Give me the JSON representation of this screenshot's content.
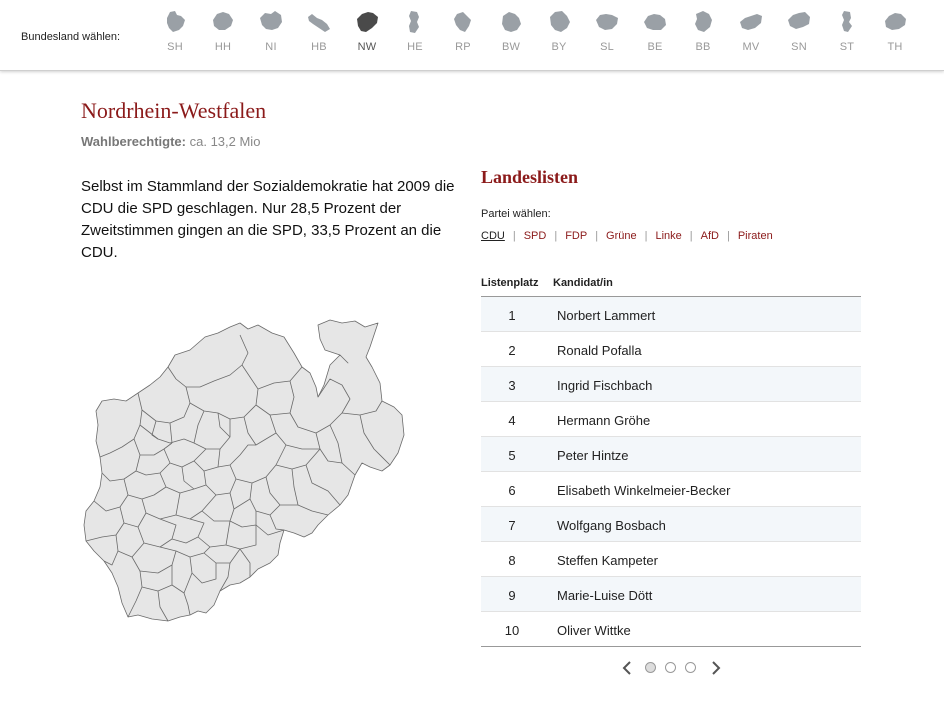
{
  "header": {
    "label": "Bundesland wählen:",
    "states": [
      {
        "abbr": "SH",
        "active": false
      },
      {
        "abbr": "HH",
        "active": false
      },
      {
        "abbr": "NI",
        "active": false
      },
      {
        "abbr": "HB",
        "active": false
      },
      {
        "abbr": "NW",
        "active": true
      },
      {
        "abbr": "HE",
        "active": false
      },
      {
        "abbr": "RP",
        "active": false
      },
      {
        "abbr": "BW",
        "active": false
      },
      {
        "abbr": "BY",
        "active": false
      },
      {
        "abbr": "SL",
        "active": false
      },
      {
        "abbr": "BE",
        "active": false
      },
      {
        "abbr": "BB",
        "active": false
      },
      {
        "abbr": "MV",
        "active": false
      },
      {
        "abbr": "SN",
        "active": false
      },
      {
        "abbr": "ST",
        "active": false
      },
      {
        "abbr": "TH",
        "active": false
      }
    ]
  },
  "state": {
    "name": "Nordrhein-Westfalen",
    "voters_label": "Wahlberechtigte:",
    "voters_value": "ca. 13,2 Mio",
    "intro": "Selbst im Stammland der Sozialdemokratie hat 2009 die CDU die SPD geschlagen. Nur 28,5 Prozent der Zweitstimmen gingen an die SPD, 33,5 Prozent an die CDU."
  },
  "lists": {
    "title": "Landeslisten",
    "party_label": "Partei wählen:",
    "parties": [
      "CDU",
      "SPD",
      "FDP",
      "Grüne",
      "Linke",
      "AfD",
      "Piraten"
    ],
    "active_party": "CDU",
    "columns": [
      "Listenplatz",
      "Kandidat/in"
    ],
    "rows": [
      {
        "place": "1",
        "name": "Norbert Lammert"
      },
      {
        "place": "2",
        "name": "Ronald Pofalla"
      },
      {
        "place": "3",
        "name": "Ingrid Fischbach"
      },
      {
        "place": "4",
        "name": "Hermann Gröhe"
      },
      {
        "place": "5",
        "name": "Peter Hintze"
      },
      {
        "place": "6",
        "name": "Elisabeth Winkelmeier-Becker"
      },
      {
        "place": "7",
        "name": "Wolfgang Bosbach"
      },
      {
        "place": "8",
        "name": "Steffen Kampeter"
      },
      {
        "place": "9",
        "name": "Marie-Luise Dött"
      },
      {
        "place": "10",
        "name": "Oliver Wittke"
      }
    ],
    "pager": {
      "pages": 3,
      "current": 1
    }
  },
  "colors": {
    "accent": "#8b1a1a",
    "state_inactive": "#9aa0a6",
    "state_active": "#4a4a4a",
    "map_fill": "#e6e6e6",
    "map_stroke": "#6a6a6a"
  }
}
